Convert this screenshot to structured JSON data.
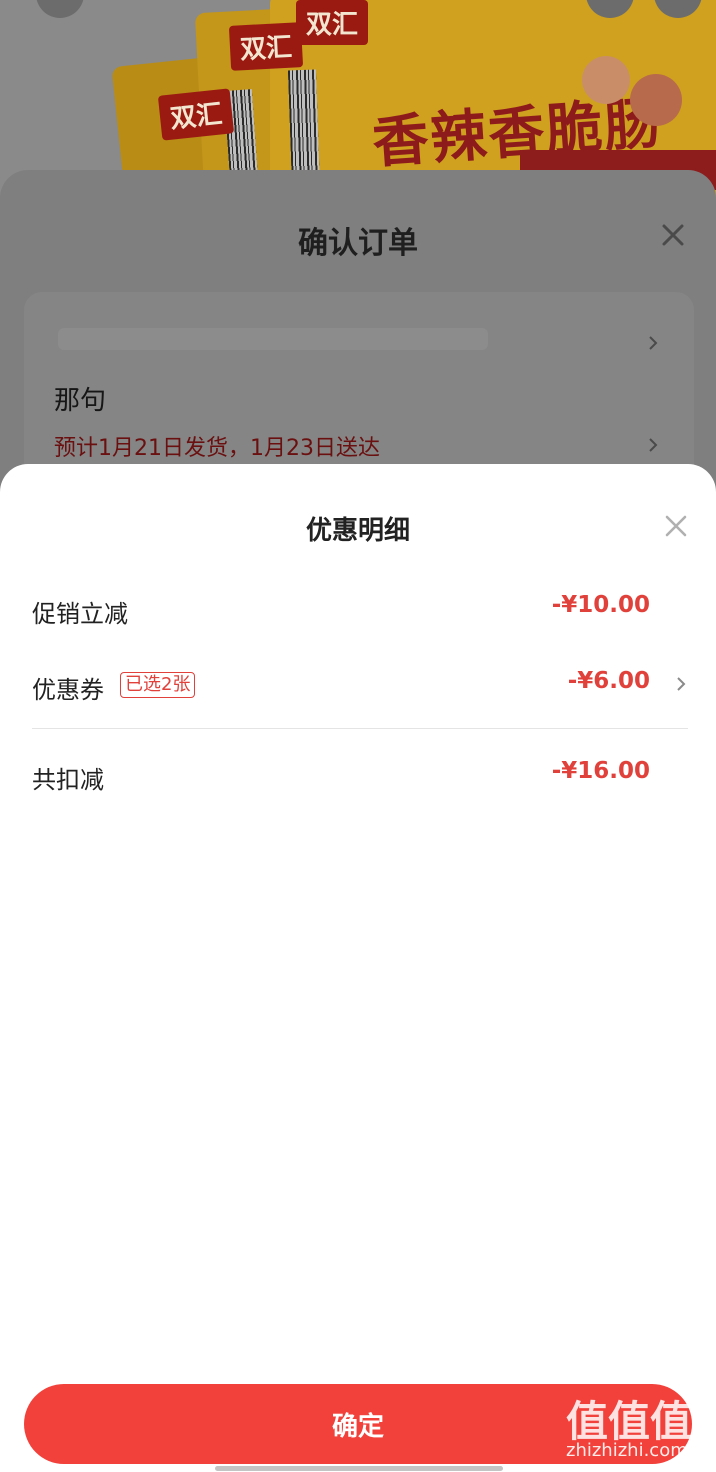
{
  "product_banner": {
    "brand": "双汇",
    "product_name": "香辣香脆肠"
  },
  "order_sheet": {
    "title": "确认订单",
    "recipient_name": "那句",
    "delivery_estimate": "预计1月21日发货，1月23日送达"
  },
  "discount_sheet": {
    "title": "优惠明细",
    "rows": [
      {
        "label": "促销立减",
        "amount": "-¥10.00"
      },
      {
        "label": "优惠券",
        "badge": "已选2张",
        "amount": "-¥6.00"
      }
    ],
    "total": {
      "label": "共扣减",
      "amount": "-¥16.00"
    }
  },
  "confirm_button": {
    "label": "确定"
  },
  "watermark": {
    "logo": "值值值",
    "url": "zhizhizhi.com"
  },
  "colors": {
    "accent": "#f2403a",
    "discount_text": "#e0413b",
    "dim_overlay": "#7f7f7f"
  },
  "icons": [
    "close-icon",
    "chevron-right-icon"
  ]
}
